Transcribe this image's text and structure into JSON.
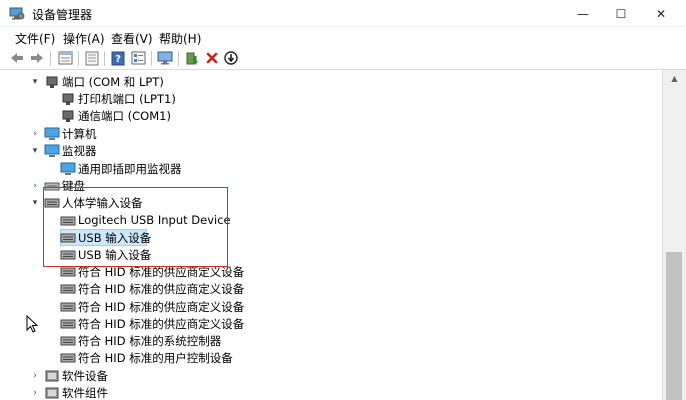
{
  "window": {
    "title": "设备管理器",
    "minimize": "—",
    "maximize": "☐",
    "close": "✕"
  },
  "menu": [
    "文件(F)",
    "操作(A)",
    "查看(V)",
    "帮助(H)"
  ],
  "toolbar": {
    "icons": [
      "back-icon",
      "forward-icon",
      "properties-icon",
      "show-hidden-icon",
      "help-icon",
      "list-icon",
      "monitor-scan-icon",
      "update-driver-icon",
      "uninstall-icon",
      "disable-icon"
    ]
  },
  "tree": {
    "rows": [
      {
        "label": "端口 (COM 和 LPT)",
        "level": 0,
        "expanded": true,
        "icon": "port-icon"
      },
      {
        "label": "打印机端口 (LPT1)",
        "level": 1,
        "icon": "port-icon"
      },
      {
        "label": "通信端口 (COM1)",
        "level": 1,
        "icon": "port-icon"
      },
      {
        "label": "计算机",
        "level": 0,
        "expanded": false,
        "icon": "computer-icon"
      },
      {
        "label": "监视器",
        "level": 0,
        "expanded": true,
        "icon": "monitor-icon"
      },
      {
        "label": "通用即插即用监视器",
        "level": 1,
        "icon": "monitor-icon"
      },
      {
        "label": "键盘",
        "level": 0,
        "expanded": false,
        "icon": "keyboard-icon"
      },
      {
        "label": "人体学输入设备",
        "level": 0,
        "expanded": true,
        "icon": "hid-icon"
      },
      {
        "label": "Logitech USB Input Device",
        "level": 1,
        "icon": "hid-icon"
      },
      {
        "label": "USB 输入设备",
        "level": 1,
        "icon": "hid-icon",
        "selected": true
      },
      {
        "label": "USB 输入设备",
        "level": 1,
        "icon": "hid-icon"
      },
      {
        "label": "符合 HID 标准的供应商定义设备",
        "level": 1,
        "icon": "hid-icon"
      },
      {
        "label": "符合 HID 标准的供应商定义设备",
        "level": 1,
        "icon": "hid-icon"
      },
      {
        "label": "符合 HID 标准的供应商定义设备",
        "level": 1,
        "icon": "hid-icon"
      },
      {
        "label": "符合 HID 标准的供应商定义设备",
        "level": 1,
        "icon": "hid-icon"
      },
      {
        "label": "符合 HID 标准的系统控制器",
        "level": 1,
        "icon": "hid-icon"
      },
      {
        "label": "符合 HID 标准的用户控制设备",
        "level": 1,
        "icon": "hid-icon"
      },
      {
        "label": "软件设备",
        "level": 0,
        "expanded": false,
        "icon": "software-device-icon"
      },
      {
        "label": "软件组件",
        "level": 0,
        "expanded": false,
        "icon": "software-component-icon"
      }
    ]
  },
  "colors": {
    "selection": "#cce8ff",
    "highlight_box": "#cc2b2b",
    "uninstall_red": "#d11f1f"
  }
}
